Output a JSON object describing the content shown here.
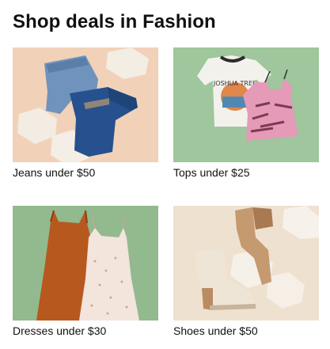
{
  "widget": {
    "title": "Shop deals in Fashion",
    "tiles": [
      {
        "label": "Jeans under $50",
        "image": "jeans-photo",
        "bg": "#f2d4bc"
      },
      {
        "label": "Tops under $25",
        "image": "tops-photo",
        "bg": "#9cc49a"
      },
      {
        "label": "Dresses under $30",
        "image": "dresses-photo",
        "bg": "#93b98e"
      },
      {
        "label": "Shoes under $50",
        "image": "shoes-photo",
        "bg": "#efe1cf"
      }
    ]
  }
}
